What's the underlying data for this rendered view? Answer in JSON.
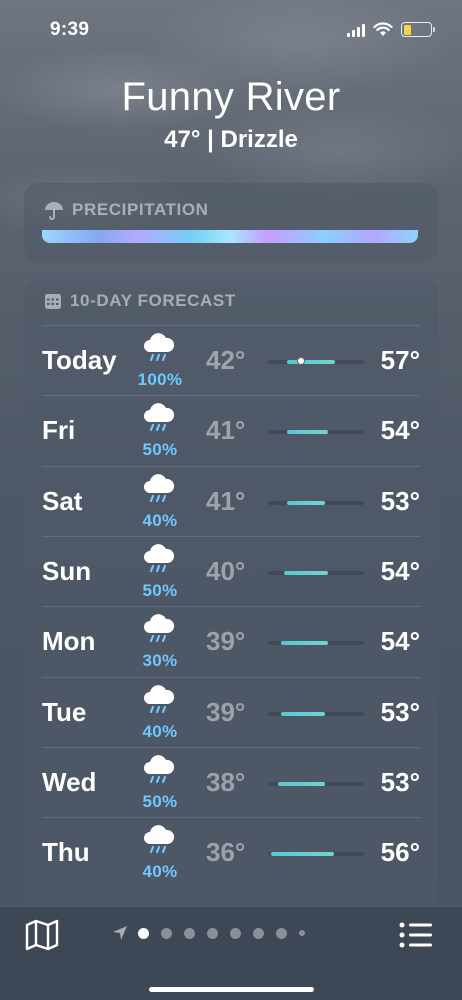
{
  "status_bar": {
    "time": "9:39"
  },
  "location": {
    "city": "Funny River",
    "condition": "47° | Drizzle"
  },
  "precipitation": {
    "title": "PRECIPITATION",
    "icon": "umbrella-icon"
  },
  "forecast": {
    "title": "10-DAY FORECAST",
    "icon": "calendar-icon",
    "days": [
      {
        "day": "Today",
        "chance": "100%",
        "low": "42°",
        "high": "57°",
        "icon": "rain-cloud-icon",
        "range_start": 0.2,
        "range_end": 0.7,
        "current": 0.34
      },
      {
        "day": "Fri",
        "chance": "50%",
        "low": "41°",
        "high": "54°",
        "icon": "rain-cloud-icon",
        "range_start": 0.2,
        "range_end": 0.62
      },
      {
        "day": "Sat",
        "chance": "40%",
        "low": "41°",
        "high": "53°",
        "icon": "rain-cloud-icon",
        "range_start": 0.2,
        "range_end": 0.59
      },
      {
        "day": "Sun",
        "chance": "50%",
        "low": "40°",
        "high": "54°",
        "icon": "rain-cloud-icon",
        "range_start": 0.17,
        "range_end": 0.62
      },
      {
        "day": "Mon",
        "chance": "30%",
        "low": "39°",
        "high": "54°",
        "icon": "rain-cloud-icon",
        "range_start": 0.14,
        "range_end": 0.62
      },
      {
        "day": "Tue",
        "chance": "40%",
        "low": "39°",
        "high": "53°",
        "icon": "rain-cloud-icon",
        "range_start": 0.14,
        "range_end": 0.59
      },
      {
        "day": "Wed",
        "chance": "50%",
        "low": "38°",
        "high": "53°",
        "icon": "rain-cloud-icon",
        "range_start": 0.1,
        "range_end": 0.59
      },
      {
        "day": "Thu",
        "chance": "40%",
        "low": "36°",
        "high": "56°",
        "icon": "rain-cloud-icon",
        "range_start": 0.03,
        "range_end": 0.69
      }
    ]
  },
  "bottom_bar": {
    "map_icon": "map-icon",
    "list_icon": "list-icon",
    "location_icon": "location-arrow-icon",
    "pages": 8,
    "active_page": 0
  },
  "colors": {
    "chance": "#6ec9ff",
    "range": "#56c9d4",
    "battery": "#f5d547"
  }
}
